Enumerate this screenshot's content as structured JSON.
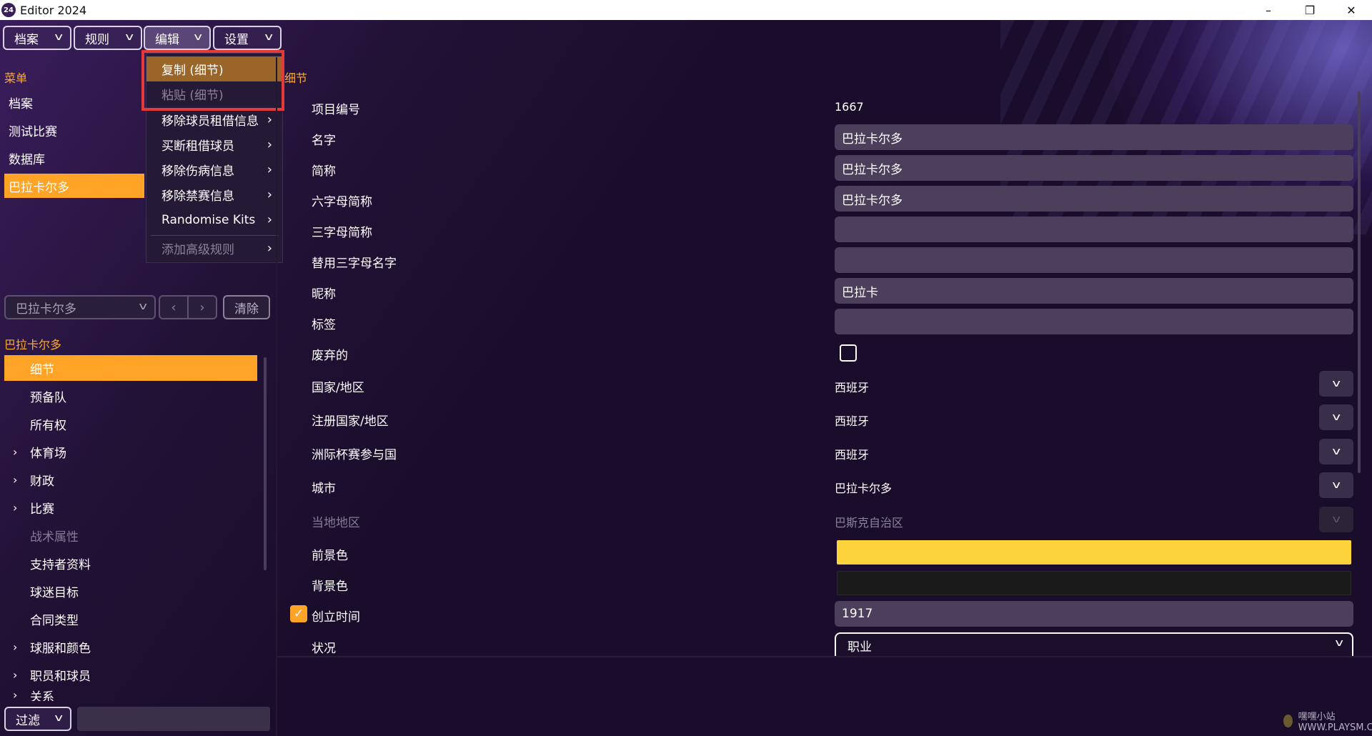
{
  "window": {
    "title": "Editor 2024",
    "logo_text": "24",
    "minimize": "–",
    "restore": "❐",
    "close": "✕"
  },
  "menubar": [
    {
      "label": "档案"
    },
    {
      "label": "规则"
    },
    {
      "label": "编辑"
    },
    {
      "label": "设置"
    }
  ],
  "left_menu": {
    "heading": "菜单",
    "items": [
      "档案",
      "测试比赛",
      "数据库",
      "巴拉卡尔多"
    ],
    "active_index": 3
  },
  "edit_dropdown": {
    "items": [
      {
        "label": "复制 (细节)"
      },
      {
        "label": "粘贴 (细节)"
      },
      {
        "label": "移除球员租借信息"
      },
      {
        "label": "买断租借球员"
      },
      {
        "label": "移除伤病信息"
      },
      {
        "label": "移除禁赛信息"
      },
      {
        "label": "Randomise Kits"
      },
      {
        "label": "添加高级规则"
      }
    ],
    "arrow": "›"
  },
  "nav": {
    "combo_value": "巴拉卡尔多",
    "prev": "‹",
    "next": "›",
    "clear_label": "清除"
  },
  "tree": {
    "heading": "巴拉卡尔多",
    "items": [
      {
        "label": "细节"
      },
      {
        "label": "预备队"
      },
      {
        "label": "所有权"
      },
      {
        "label": "体育场"
      },
      {
        "label": "财政"
      },
      {
        "label": "比赛"
      },
      {
        "label": "战术属性"
      },
      {
        "label": "支持者资料"
      },
      {
        "label": "球迷目标"
      },
      {
        "label": "合同类型"
      },
      {
        "label": "球服和颜色"
      },
      {
        "label": "职员和球员"
      },
      {
        "label": "关系"
      }
    ],
    "expander": "›"
  },
  "filter": {
    "label": "过滤",
    "value": ""
  },
  "details": {
    "heading": "细节",
    "fields": {
      "id": {
        "label": "项目编号",
        "value": "1667"
      },
      "name": {
        "label": "名字",
        "value": "巴拉卡尔多"
      },
      "short_name": {
        "label": "简称",
        "value": "巴拉卡尔多"
      },
      "six_letter": {
        "label": "六字母简称",
        "value": "巴拉卡尔多"
      },
      "three_letter": {
        "label": "三字母简称",
        "value": ""
      },
      "alt_three_letter": {
        "label": "替用三字母名字",
        "value": ""
      },
      "nickname": {
        "label": "昵称",
        "value": "巴拉卡"
      },
      "tag": {
        "label": "标签",
        "value": ""
      },
      "abandoned": {
        "label": "废弃的",
        "checked": false
      },
      "nation": {
        "label": "国家/地区",
        "value": "西班牙"
      },
      "registered_nation": {
        "label": "注册国家/地区",
        "value": "西班牙"
      },
      "continental_nation": {
        "label": "洲际杯赛参与国",
        "value": "西班牙"
      },
      "city": {
        "label": "城市",
        "value": "巴拉卡尔多"
      },
      "local_region": {
        "label": "当地地区",
        "value": "巴斯克自治区"
      },
      "foreground": {
        "label": "前景色",
        "color": "#fdd33c"
      },
      "background": {
        "label": "背景色",
        "color": "#1a1a1a"
      },
      "founded": {
        "label": "创立时间",
        "value": "1917",
        "checked": true
      },
      "status": {
        "label": "状况",
        "value": "职业"
      }
    }
  },
  "icons": {
    "chevron_down": "chevron-down-icon",
    "chevron_right": "chevron-right-icon",
    "check": "check-icon"
  },
  "colors": {
    "accent": "#ffa426",
    "highlight": "#9a6528",
    "outline": "#e53a3a",
    "input_bg": "#4b3f5c"
  },
  "watermark": "嘿嘿小站 WWW.PLAYSM.CC"
}
